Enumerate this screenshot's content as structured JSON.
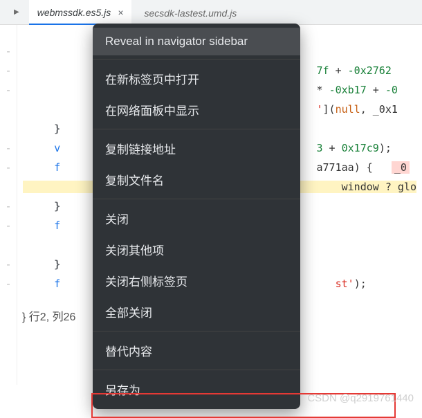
{
  "tabs": {
    "active": {
      "label": "webmssdk.es5.js",
      "close": "×"
    },
    "inactive": {
      "label": "secsdk-lastest.umd.js"
    }
  },
  "gutter_marks": [
    "-",
    "-",
    "-",
    "",
    "",
    "-",
    "-",
    "",
    "-",
    "-",
    "",
    "-",
    "-",
    ""
  ],
  "code": {
    "l1_a": "7f",
    "l1_b": " + ",
    "l1_c": "-0x2762",
    "l2_a": "* ",
    "l2_b": "-0xb17",
    "l2_c": " + ",
    "l2_d": "-0",
    "l3_a": "'",
    "l3_b": "](",
    "l3_c": "null",
    "l3_d": ", _0x1",
    "l6_a": "3",
    "l6_b": " + ",
    "l6_c": "0x17c9",
    "l6_d": ");",
    "l7_a": "a771aa",
    "l7_b": ") {   ",
    "l7_c": "_0",
    "l8_a": " window ? glo",
    "l13_a": "st'",
    "l13_b": ");",
    "brace": "}",
    "v": "v",
    "f": "f"
  },
  "status": "}  行2, 列26",
  "menu": {
    "items": [
      "Reveal in navigator sidebar",
      "在新标签页中打开",
      "在网络面板中显示",
      "复制链接地址",
      "复制文件名",
      "关闭",
      "关闭其他项",
      "关闭右侧标签页",
      "全部关闭",
      "替代内容",
      "另存为"
    ]
  },
  "watermark": "CSDN @q2919761440"
}
